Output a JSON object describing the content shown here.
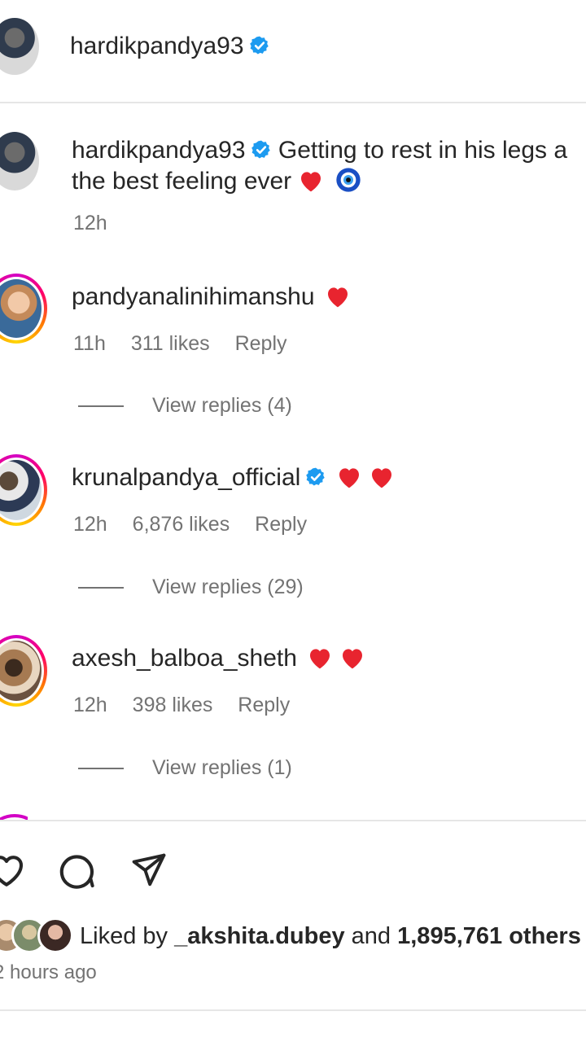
{
  "header": {
    "username": "hardikpandya93"
  },
  "caption": {
    "username": "hardikpandya93",
    "text_line1": "Getting to rest in his legs a",
    "text_line2": "the best feeling ever",
    "time": "12h"
  },
  "comments": [
    {
      "username": "pandyanalinihimanshu",
      "time": "11h",
      "likes": "311 likes",
      "reply_label": "Reply",
      "view_replies": "View replies (4)"
    },
    {
      "username": "krunalpandya_official",
      "time": "12h",
      "likes": "6,876 likes",
      "reply_label": "Reply",
      "view_replies": "View replies (29)"
    },
    {
      "username": "axesh_balboa_sheth",
      "time": "12h",
      "likes": "398 likes",
      "reply_label": "Reply",
      "view_replies": "View replies (1)"
    }
  ],
  "likes": {
    "liked_by": "Liked by",
    "user": "_akshita.dubey",
    "and": "and",
    "count": "1,895,761 others"
  },
  "post_time": "2 hours ago",
  "colors": {
    "verified": "#1d9bf0",
    "heart": "#e8242f",
    "meta": "#737373"
  }
}
